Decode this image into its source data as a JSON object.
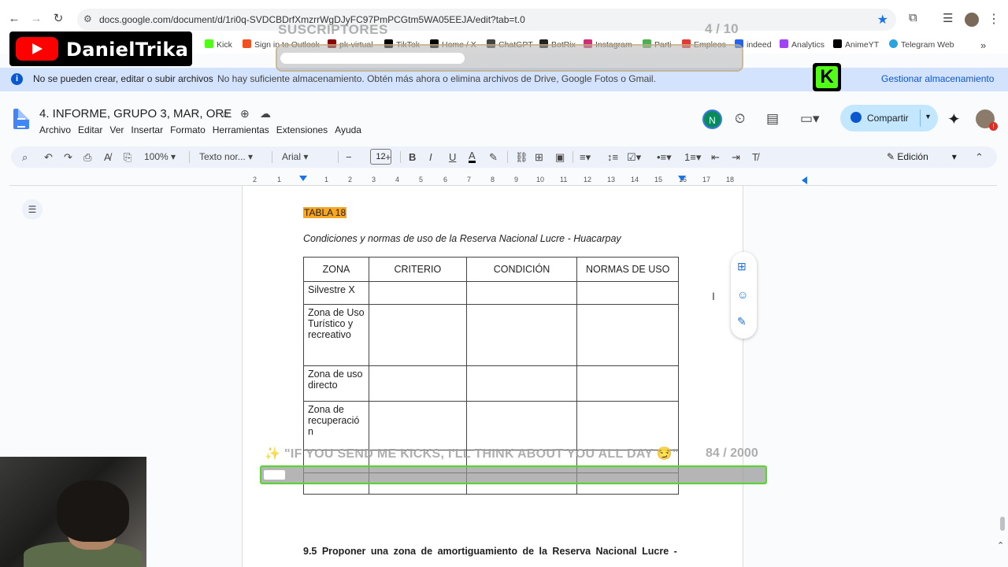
{
  "browser": {
    "url": "docs.google.com/document/d/1ri0q-SVDCBDrfXmzrrWgDJyFC97PmPCGtm5WA05EEJA/edit?tab=t.0",
    "bookmarks": [
      "Kick",
      "Sign in to Outlook",
      "pk-virtual",
      "TikTok",
      "Home / X",
      "ChatGPT",
      "BotRix",
      "Instagram",
      "Parti",
      "Empleos",
      "indeed",
      "Analytics",
      "AnimeYT",
      "Telegram Web"
    ]
  },
  "overlay": {
    "channel_name": "DanielTrika",
    "subs_label": "SUSCRIPTORES",
    "subs_count": "4 / 10",
    "subs_progress": 0.4,
    "kick_message": "\"IF YOU SEND ME KICKS, I'LL THINK ABOUT YOU ALL DAY 😏\"",
    "kick_count": "84 / 2000",
    "kick_progress": 0.042
  },
  "banner": {
    "title": "No se pueden crear, editar o subir archivos",
    "message": "No hay suficiente almacenamiento. Obtén más ahora o elimina archivos de Drive, Google Fotos o Gmail.",
    "action": "Gestionar almacenamiento"
  },
  "docs": {
    "title": "4. INFORME, GRUPO 3, MAR, ORE",
    "menus": [
      "Archivo",
      "Editar",
      "Ver",
      "Insertar",
      "Formato",
      "Herramientas",
      "Extensiones",
      "Ayuda"
    ],
    "collaborator_initial": "N",
    "share_label": "Compartir"
  },
  "toolbar": {
    "zoom": "100%",
    "style": "Texto nor...",
    "font": "Arial",
    "font_size": "12",
    "mode": "Edición"
  },
  "ruler": [
    "2",
    "1",
    "1",
    "2",
    "3",
    "4",
    "5",
    "6",
    "7",
    "8",
    "9",
    "10",
    "11",
    "12",
    "13",
    "14",
    "15",
    "16",
    "17",
    "18"
  ],
  "document": {
    "table_label": "TABLA 18",
    "caption": "Condiciones y normas de uso de la Reserva Nacional Lucre - Huacarpay",
    "headers": [
      "ZONA",
      "CRITERIO",
      "CONDICIÓN",
      "NORMAS DE USO"
    ],
    "rows": [
      "Silvestre X",
      "Zona de Uso Turístico y recreativo",
      "Zona de uso directo",
      "Zona de recuperació n",
      "",
      ""
    ],
    "section_heading": "9.5 Proponer una zona de amortiguamiento de la Reserva Nacional Lucre -"
  },
  "colors": {
    "accent": "#1a73e8",
    "banner_bg": "#d3e3fd",
    "share_bg": "#c2e7ff",
    "highlight": "#f5a623",
    "kick_green": "#53fc18",
    "youtube_red": "#ff0000"
  }
}
